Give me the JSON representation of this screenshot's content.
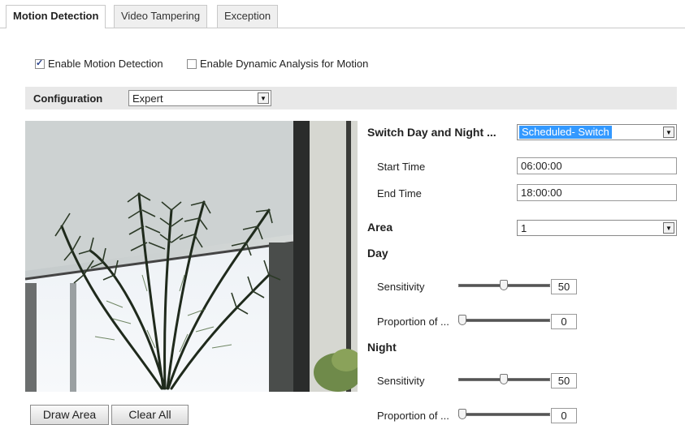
{
  "tabs": [
    {
      "label": "Motion Detection",
      "active": true
    },
    {
      "label": "Video Tampering",
      "active": false
    },
    {
      "label": "Exception",
      "active": false
    }
  ],
  "options": {
    "enable_motion": {
      "label": "Enable Motion Detection",
      "checked": true
    },
    "enable_dynamic": {
      "label": "Enable Dynamic Analysis for Motion",
      "checked": false
    }
  },
  "configuration": {
    "label": "Configuration",
    "value": "Expert"
  },
  "buttons": {
    "draw_area": "Draw Area",
    "clear_all": "Clear All"
  },
  "settings": {
    "switch_label": "Switch Day and Night ...",
    "switch_value": "Scheduled- Switch",
    "start_time_label": "Start Time",
    "start_time": "06:00:00",
    "end_time_label": "End Time",
    "end_time": "18:00:00",
    "area_label": "Area",
    "area_value": "1",
    "day": {
      "heading": "Day",
      "sensitivity_label": "Sensitivity",
      "sensitivity": "50",
      "proportion_label": "Proportion of ...",
      "proportion": "0"
    },
    "night": {
      "heading": "Night",
      "sensitivity_label": "Sensitivity",
      "sensitivity": "50",
      "proportion_label": "Proportion of ...",
      "proportion": "0"
    }
  }
}
